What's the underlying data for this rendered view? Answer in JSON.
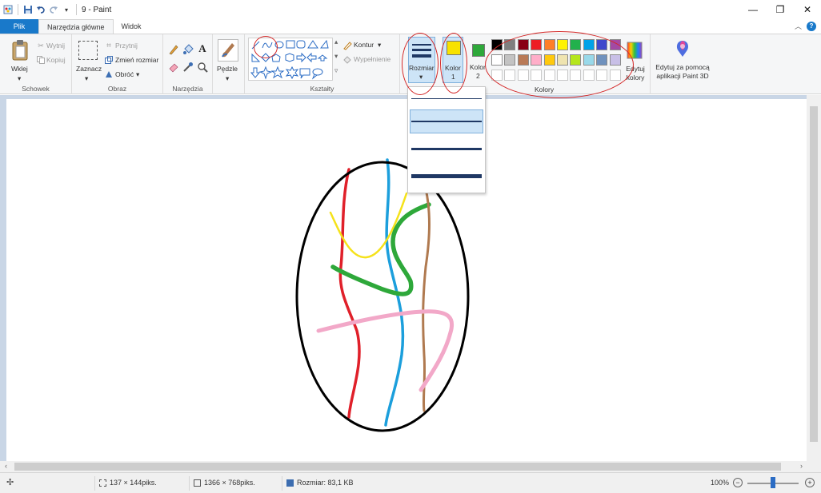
{
  "window": {
    "title": "9 - Paint"
  },
  "qat": {
    "icons": [
      "paint-app-icon",
      "save-icon",
      "undo-icon",
      "redo-icon",
      "customize-icon"
    ]
  },
  "tabs": [
    {
      "label": "Plik"
    },
    {
      "label": "Narzędzia główne"
    },
    {
      "label": "Widok"
    }
  ],
  "ribbon": {
    "clipboard": {
      "paste": "Wklej",
      "cut": "Wytnij",
      "copy": "Kopiuj",
      "group": "Schowek"
    },
    "image": {
      "select": "Zaznacz",
      "crop": "Przytnij",
      "resize": "Zmień rozmiar",
      "rotate": "Obróć",
      "group": "Obraz"
    },
    "tools": {
      "group": "Narzędzia"
    },
    "brushes": {
      "label": "Pędzle"
    },
    "shapes": {
      "outline": "Kontur",
      "fill": "Wypełnienie",
      "group": "Kształty"
    },
    "size": {
      "label": "Rozmiar"
    },
    "color1": {
      "label": "Kolor",
      "number": "1",
      "value": "#f7e200"
    },
    "color2": {
      "label": "Kolor",
      "number": "2",
      "value": "#2ea83a"
    },
    "colors": {
      "group": "Kolory",
      "row1": [
        "#000000",
        "#7f7f7f",
        "#880015",
        "#ed1c24",
        "#ff7f27",
        "#fff200",
        "#22b14c",
        "#00a2e8",
        "#3f48cc",
        "#a349a4"
      ],
      "row2": [
        "#ffffff",
        "#c3c3c3",
        "#b97a57",
        "#ffaec9",
        "#ffc90e",
        "#efe4b0",
        "#b5e61d",
        "#99d9ea",
        "#7092be",
        "#c8bfe7"
      ],
      "row3": [
        "#ffffff",
        "#ffffff",
        "#ffffff",
        "#ffffff",
        "#ffffff",
        "#ffffff",
        "#ffffff",
        "#ffffff",
        "#ffffff",
        "#ffffff"
      ],
      "edit": "Edytuj kolory"
    },
    "paint3d": {
      "label": "Edytuj za pomocą aplikacji Paint 3D"
    }
  },
  "size_dropdown": {
    "options": [
      "1px",
      "3px",
      "5px",
      "8px"
    ],
    "selected_index": 1
  },
  "status": {
    "selection": "137 × 144piks.",
    "canvas_size": "1366 × 768piks.",
    "file_size": "Rozmiar: 83,1 KB",
    "zoom": "100%"
  },
  "drawing": {
    "colors": {
      "ellipse": "#000000",
      "red": "#e0202a",
      "blue": "#1c9fdc",
      "yellow": "#f5e21b",
      "green": "#2ea83a",
      "brown": "#b07a50",
      "pink": "#f2a8c8"
    }
  }
}
